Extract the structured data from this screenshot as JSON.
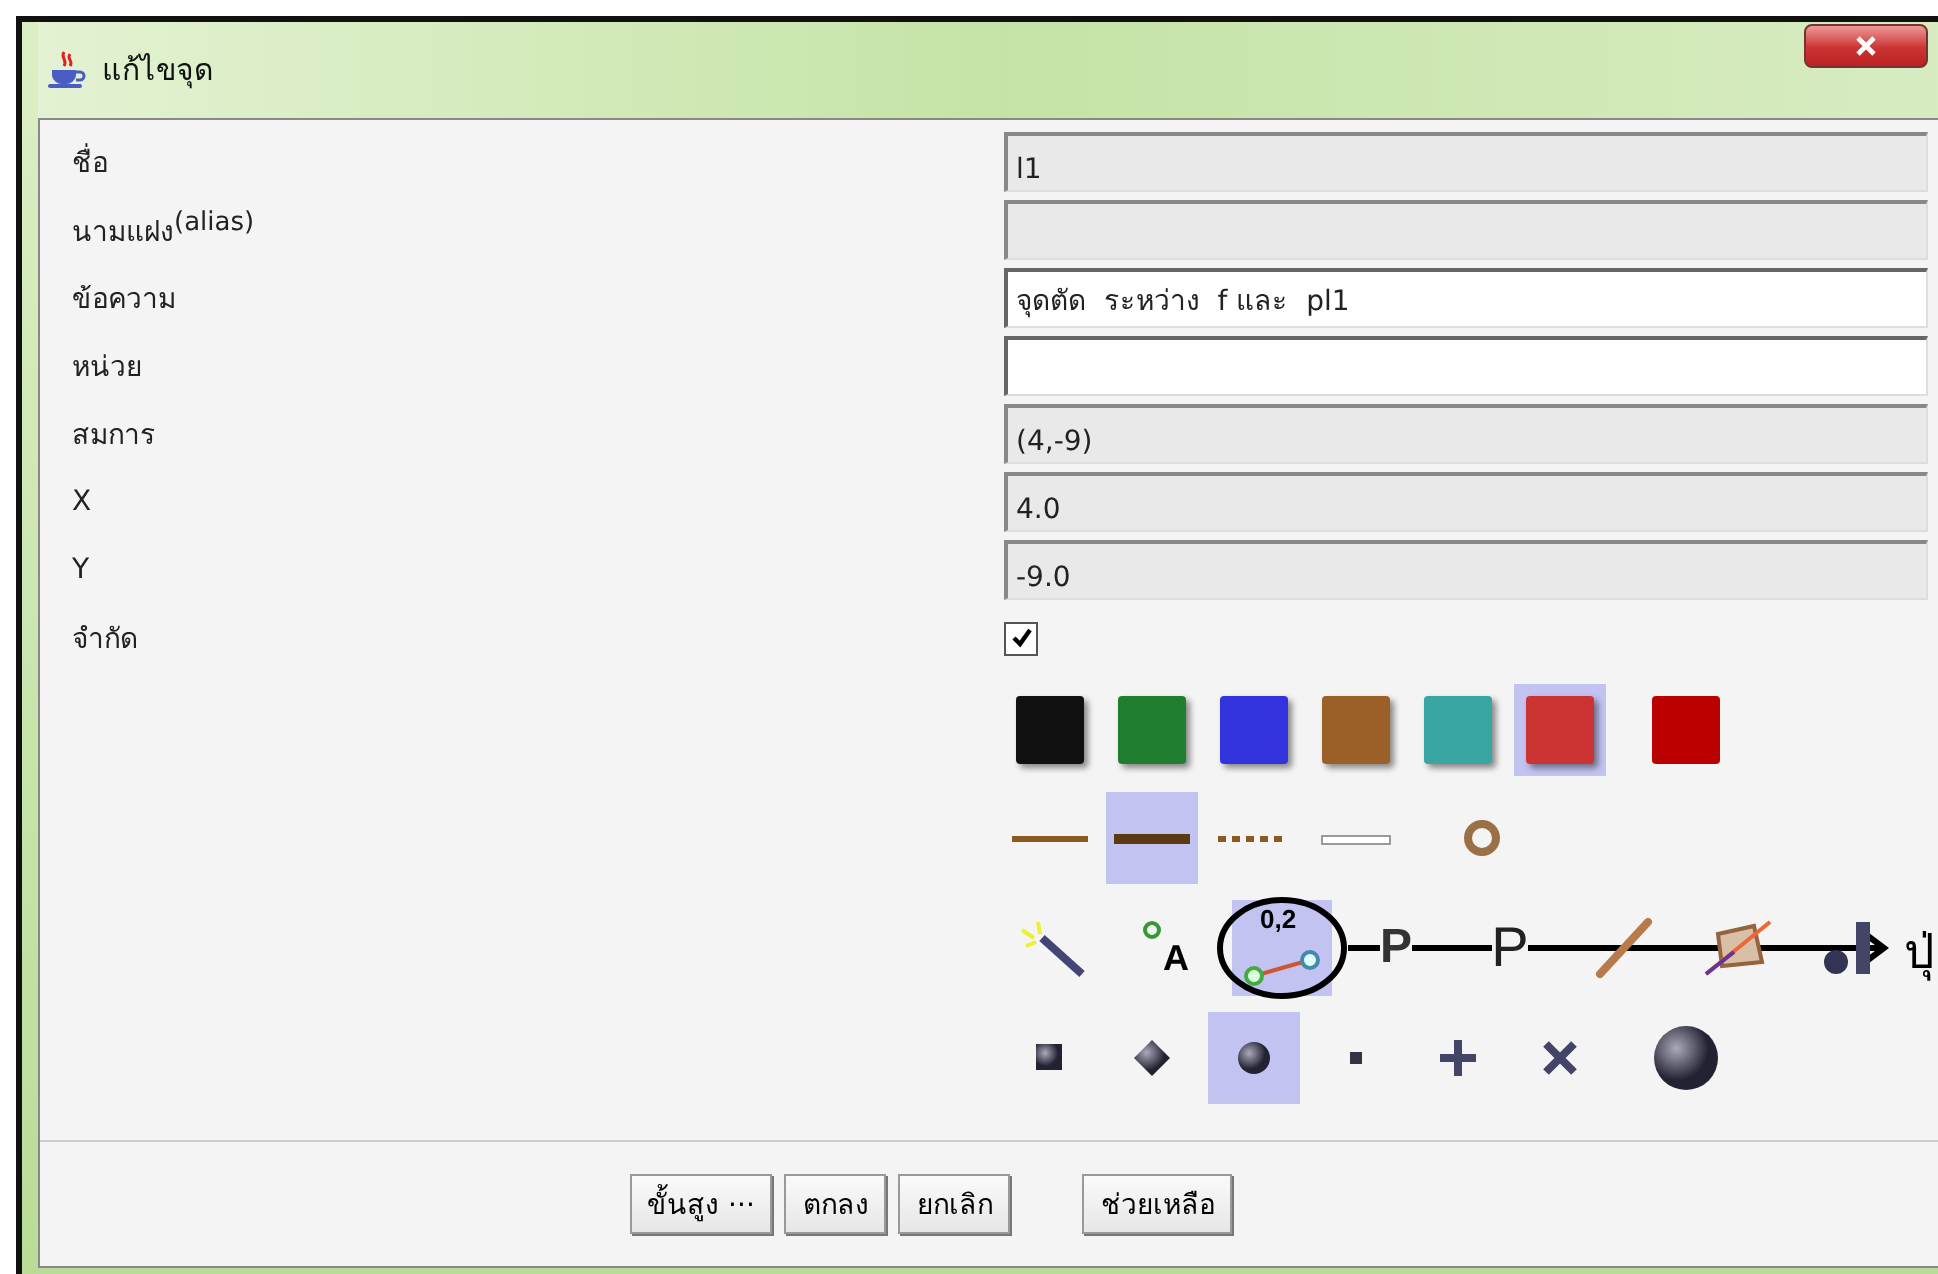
{
  "window": {
    "title": "แก้ไขจุด"
  },
  "fields": [
    {
      "kind": "text",
      "label": "ชื่อ",
      "value": "l1",
      "editable": false
    },
    {
      "kind": "text",
      "label": "นามแฝง$^{(alias)}$",
      "editable": false
    },
    {
      "kind": "text",
      "label": "ข้อความ",
      "value": "จุดตัด  ระหว่าง  f และ  pl1",
      "editable": true
    },
    {
      "kind": "text",
      "label": "หน่วย",
      "editable": true
    },
    {
      "kind": "text",
      "label": "สมการ",
      "value": "(4,-9)",
      "editable": false
    },
    {
      "kind": "text",
      "label": "X",
      "value": "4.0",
      "editable": false
    },
    {
      "kind": "text",
      "label": "Y",
      "value": "-9.0",
      "editable": false
    },
    {
      "kind": "checkbox",
      "label": "จำกัด",
      "checked": true
    }
  ],
  "swatches": [
    {
      "color": "#111111",
      "selected": false
    },
    {
      "color": "#1f7f2f",
      "selected": false
    },
    {
      "color": "#3333dd",
      "selected": false
    },
    {
      "color": "#9b6028",
      "selected": false
    },
    {
      "color": "#3aa6a2",
      "selected": false
    },
    {
      "color": "#cc3333",
      "selected": true
    },
    {
      "color": "#bb0000",
      "selected": false
    }
  ],
  "line_styles": [
    {
      "kind": "thin",
      "selected": false
    },
    {
      "kind": "thick",
      "selected": true
    },
    {
      "kind": "dotted",
      "selected": false
    },
    {
      "kind": "hidden",
      "selected": false
    },
    {
      "kind": "ring",
      "selected": false
    }
  ],
  "tools": [
    {
      "kind": "wand",
      "selected": false
    },
    {
      "kind": "label",
      "text": "A",
      "selected": false
    },
    {
      "kind": "caption",
      "text": "0,2",
      "selected": true
    },
    {
      "kind": "bold-letter",
      "text": "P",
      "selected": false
    },
    {
      "kind": "letter",
      "text": "P",
      "selected": false
    },
    {
      "kind": "slash",
      "selected": false
    },
    {
      "kind": "polygon",
      "selected": false
    },
    {
      "kind": "layer",
      "selected": false
    }
  ],
  "point_styles": [
    {
      "kind": "square",
      "selected": false
    },
    {
      "kind": "diamond",
      "selected": false
    },
    {
      "kind": "dot",
      "selected": true
    },
    {
      "kind": "small-square",
      "selected": false
    },
    {
      "kind": "plus",
      "selected": false
    },
    {
      "kind": "cross",
      "selected": false
    },
    {
      "kind": "big-dot",
      "selected": false
    }
  ],
  "annotation": {
    "label": "ปุ่"
  },
  "buttons": [
    "ขั้นสูง ···",
    "ตกลง",
    "ยกเลิก",
    "ช่วยเหลือ"
  ]
}
